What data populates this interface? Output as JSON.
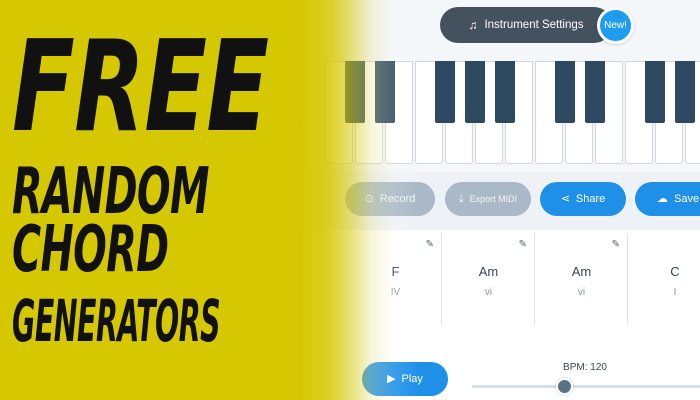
{
  "instrument_settings": {
    "label": "Instrument Settings",
    "icon": "music-note-icon",
    "badge": "New!"
  },
  "actions": {
    "record": {
      "label": "Record",
      "icon": "record-icon"
    },
    "export_midi": {
      "label": "Export MIDI",
      "icon": "download-icon"
    },
    "share": {
      "label": "Share",
      "icon": "share-icon"
    },
    "save": {
      "label": "Save",
      "icon": "cloud-upload-icon"
    }
  },
  "chords": [
    {
      "name": "F",
      "numeral": "IV"
    },
    {
      "name": "Am",
      "numeral": "vi"
    },
    {
      "name": "Am",
      "numeral": "vi"
    },
    {
      "name": "C",
      "numeral": "I"
    }
  ],
  "playback": {
    "play_label": "Play",
    "bpm_label": "BPM: 120",
    "bpm": 120
  },
  "headline": {
    "line1": "FREE",
    "line2": "RANDOM",
    "line3": "CHORD",
    "line4": "GENERATORS"
  },
  "colors": {
    "accent": "#1e90e8",
    "overlay_yellow": "#d6c800",
    "piano_black": "#2e4a63",
    "disabled_button": "#a9b9c7"
  }
}
